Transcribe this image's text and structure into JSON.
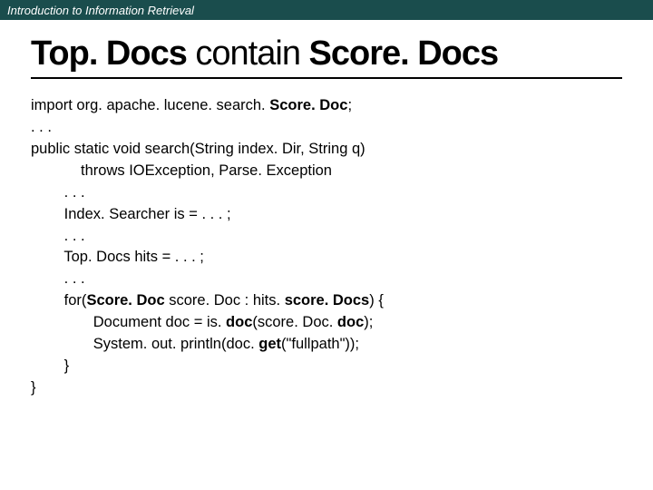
{
  "header": "Introduction to Information Retrieval",
  "title_parts": {
    "p1": "Top. Docs",
    "p2": " contain ",
    "p3": "Score. Docs"
  },
  "code": {
    "l1a": "import org. apache. lucene. search. ",
    "l1b": "Score. Doc",
    "l1c": ";",
    "l2": ". . .",
    "l3": "public static void search(String index. Dir, String q)",
    "l4": "            throws IOException, Parse. Exception",
    "l5": "        . . .",
    "l6": "        Index. Searcher is = . . . ;",
    "l7": "        . . .",
    "l8": "        Top. Docs hits = . . . ;",
    "l9": "        . . .",
    "l10a": "        for(",
    "l10b": "Score. Doc",
    "l10c": " score. Doc : hits. ",
    "l10d": "score. Docs",
    "l10e": ") {",
    "l11a": "               Document doc = is. ",
    "l11b": "doc",
    "l11c": "(score. Doc. ",
    "l11d": "doc",
    "l11e": ");",
    "l12a": "               System. out. println(doc. ",
    "l12b": "get",
    "l12c": "(\"fullpath\"));",
    "l13": "        }",
    "l14": "}"
  }
}
